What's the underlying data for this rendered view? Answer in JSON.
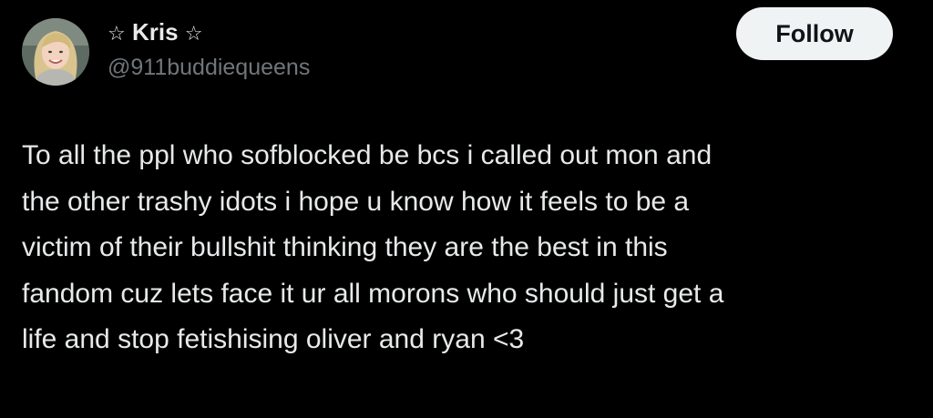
{
  "tweet": {
    "author": {
      "star_left": "☆",
      "name": "Kris",
      "star_right": "☆",
      "handle": "@911buddiequeens",
      "avatar": "avatar-photo-icon"
    },
    "follow_label": "Follow",
    "text_lines": [
      "To all the ppl who sofblocked be bcs i called out mon and",
      "the other trashy idots i hope u know how it feels to be a",
      "victim of their bullshit thinking they are the best in this",
      "fandom cuz lets face it ur all morons who should just get a",
      "life and stop fetishising oliver and ryan <3"
    ]
  },
  "colors": {
    "background": "#000000",
    "text": "#e7e9ea",
    "secondary_text": "#71767b",
    "follow_button_bg": "#eff3f4",
    "follow_button_text": "#0f1419"
  }
}
